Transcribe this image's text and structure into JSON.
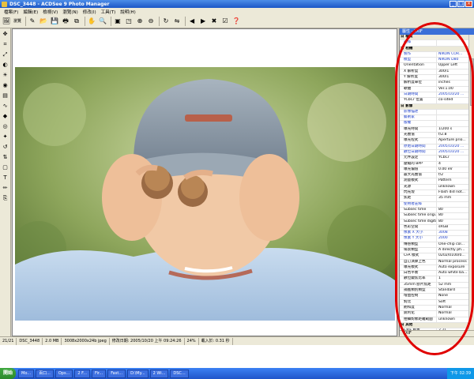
{
  "window": {
    "title": "DSC_3448 - ACDSee 9 Photo Manager",
    "minimize": "_",
    "maximize": "□",
    "close": "×"
  },
  "menu": [
    "檔案(F)",
    "編輯(E)",
    "檢視(V)",
    "瀏覽(N)",
    "修改(I)",
    "工具(T)",
    "說明(H)"
  ],
  "toolbar": {
    "browse_label": "瀏覽",
    "icons": [
      "browse-icon",
      "edit-icon",
      "open-icon",
      "save-icon",
      "print-icon",
      "copy-icon",
      "hand-icon",
      "zoom-icon",
      "fit-icon",
      "actual-size-icon",
      "zoom-in-icon",
      "zoom-out-icon",
      "rotate-icon",
      "flip-icon",
      "prev-icon",
      "next-icon",
      "delete-icon",
      "properties-icon",
      "help-icon"
    ]
  },
  "left_tools": [
    "move-icon",
    "crop-icon",
    "resize-icon",
    "adjust-icon",
    "brightness-icon",
    "color-icon",
    "levels-icon",
    "curves-icon",
    "sharpen-icon",
    "redeye-icon",
    "text-icon",
    "effects-icon",
    "rotate-tool-icon",
    "flip-tool-icon",
    "border-icon",
    "pencil-icon",
    "clone-icon"
  ],
  "exif_panel": {
    "title": "屬性 - EXIF",
    "rows": [
      {
        "type": "section",
        "label": "日 檔案"
      },
      {
        "k": "註釋",
        "v": "",
        "blue": true
      },
      {
        "type": "section",
        "label": "日 相機"
      },
      {
        "k": "製作",
        "v": "NIKON COR...",
        "blue": true
      },
      {
        "k": "模型",
        "v": "NIKON D80",
        "blue": true
      },
      {
        "k": "Orientation",
        "v": "Upper Left"
      },
      {
        "k": "X 解析度",
        "v": "300/1"
      },
      {
        "k": "Y 解析度",
        "v": "300/1"
      },
      {
        "k": "解析度單位",
        "v": "inches"
      },
      {
        "k": "軟體",
        "v": "Ver.1.00"
      },
      {
        "k": "日期時間",
        "v": "2005/10/20 ...",
        "blue": true
      },
      {
        "k": "YCbCr 位置",
        "v": "co-sited"
      },
      {
        "type": "section",
        "label": "日 影像"
      },
      {
        "k": "影像描述",
        "v": "",
        "blue": true
      },
      {
        "k": "藝術家",
        "v": "",
        "blue": true
      },
      {
        "k": "版權",
        "v": "",
        "blue": true
      },
      {
        "k": "曝光時間",
        "v": "1/200 s"
      },
      {
        "k": "光圈值",
        "v": "f/2.8"
      },
      {
        "k": "曝光程式",
        "v": "Aperture prio..."
      },
      {
        "k": "原始日期時間",
        "v": "2005/10/20 ...",
        "blue": true
      },
      {
        "k": "數位日期時間",
        "v": "2005/10/20 ...",
        "blue": true
      },
      {
        "k": "元件設定",
        "v": "YCbCr"
      },
      {
        "k": "壓縮的 BPP",
        "v": "4"
      },
      {
        "k": "曝光偏值",
        "v": "0.00 eV"
      },
      {
        "k": "最大光圈值",
        "v": "f/2"
      },
      {
        "k": "測量模式",
        "v": "Pattern"
      },
      {
        "k": "光源",
        "v": "unknown"
      },
      {
        "k": "閃光燈",
        "v": "Flash did not..."
      },
      {
        "k": "焦距",
        "v": "35 mm"
      },
      {
        "k": "使用者註釋",
        "v": "",
        "blue": true
      },
      {
        "k": "Subsec time",
        "v": "80"
      },
      {
        "k": "Subsec time origi...",
        "v": "80"
      },
      {
        "k": "Subsec time digiti...",
        "v": "80"
      },
      {
        "k": "色彩空間",
        "v": "sRGB"
      },
      {
        "k": "像素 X 大小",
        "v": "3008",
        "blue": true
      },
      {
        "k": "像素 Y 大小",
        "v": "2000",
        "blue": true
      },
      {
        "k": "傳感類型",
        "v": "One-chip col..."
      },
      {
        "k": "場景類型",
        "v": "A directly ph..."
      },
      {
        "k": "CFA 樣式",
        "v": "0202/0100/0..."
      },
      {
        "k": "自訂演算上色",
        "v": "Normal process"
      },
      {
        "k": "曝光模式",
        "v": "Auto exposure"
      },
      {
        "k": "白色平衡",
        "v": "Auto white ba..."
      },
      {
        "k": "數位變焦比率",
        "v": "1"
      },
      {
        "k": "35mm 膠片焦距",
        "v": "52 mm"
      },
      {
        "k": "捕獲類別類型",
        "v": "Standard"
      },
      {
        "k": "增益控制",
        "v": "None"
      },
      {
        "k": "對比",
        "v": "Soft"
      },
      {
        "k": "飽和度",
        "v": "Normal"
      },
      {
        "k": "銳利化",
        "v": "Normal"
      },
      {
        "k": "拍攝對象距離範圍",
        "v": "unknown"
      },
      {
        "type": "section",
        "label": "日 其他"
      },
      {
        "k": "EXIF 版本",
        "v": "2.21"
      },
      {
        "k": "FlashPix 版本",
        "v": "1.0"
      }
    ],
    "bottom_tab": "EXIF"
  },
  "statusbar": {
    "index": "21/21",
    "filename": "DSC_3448",
    "size": "2.0 MB",
    "dimensions": "3008x2000x24b jpeg",
    "modified": "修改日期: 2005/10/20 上午 09:24:26",
    "zoom": "24%",
    "load_time": "載入於: 0.31 秒"
  },
  "taskbar": {
    "start": "開始",
    "tasks": [
      "Mo...",
      "百口...",
      "Ops...",
      "2 F...",
      "Fir...",
      "Fast...",
      "D:\\My...",
      "2 Wi...",
      "DSC..."
    ],
    "clock": "下午 02:39"
  },
  "colors": {
    "annotation": "#e00000",
    "link_blue": "#1a3cc8",
    "titlebar": "#1c56c6"
  }
}
